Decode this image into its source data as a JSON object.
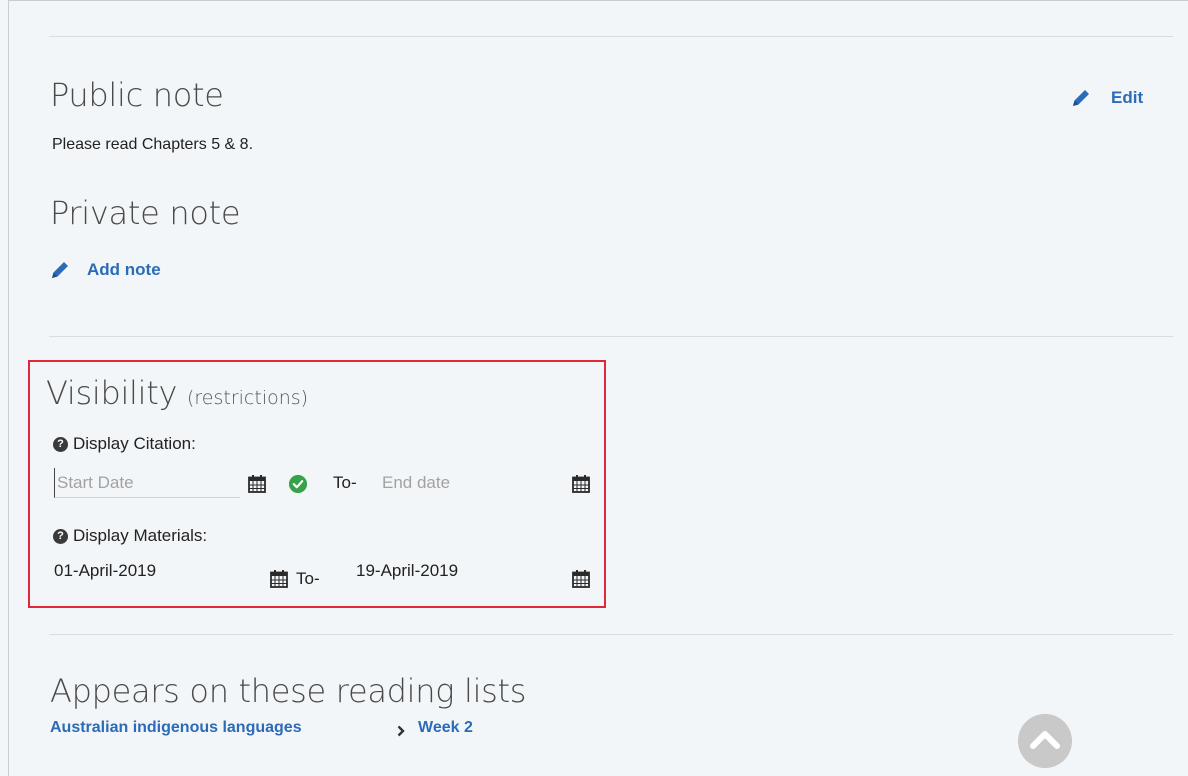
{
  "public_note": {
    "heading": "Public note",
    "text": "Please read Chapters 5 & 8.",
    "edit_label": "Edit"
  },
  "private_note": {
    "heading": "Private note",
    "add_label": "Add note"
  },
  "visibility": {
    "heading": "Visibility",
    "sub": "(restrictions)",
    "display_citation": {
      "label": "Display Citation:",
      "start_placeholder": "Start Date",
      "start_value": "",
      "to_label": "To-",
      "end_placeholder": "End date",
      "end_value": ""
    },
    "display_materials": {
      "label": "Display Materials:",
      "start_value": "01-April-2019",
      "to_label": "To-",
      "end_value": "19-April-2019"
    },
    "help_glyph": "?"
  },
  "reading_lists": {
    "heading": "Appears on these reading lists",
    "list_name": "Australian indigenous languages",
    "section_name": "Week 2"
  },
  "icons": {
    "edit": "pencil-icon",
    "calendar": "calendar-icon",
    "valid": "check-circle-icon",
    "help": "question-circle-icon",
    "breadcrumb": "chevron-right-icon",
    "scroll": "chevron-up-circle-icon"
  },
  "colors": {
    "link": "#2b6bb8",
    "highlight": "#e0283a",
    "valid": "#37a24a",
    "background": "#f3f6f8"
  }
}
